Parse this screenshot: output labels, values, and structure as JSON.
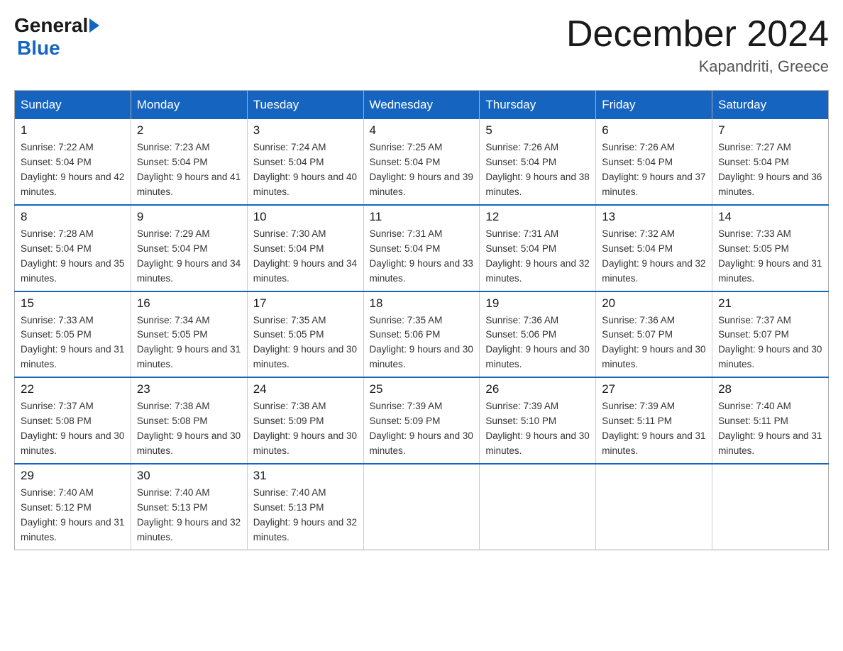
{
  "logo": {
    "general": "General",
    "blue": "Blue"
  },
  "title": "December 2024",
  "subtitle": "Kapandriti, Greece",
  "days_of_week": [
    "Sunday",
    "Monday",
    "Tuesday",
    "Wednesday",
    "Thursday",
    "Friday",
    "Saturday"
  ],
  "weeks": [
    [
      {
        "day": "1",
        "sunrise": "Sunrise: 7:22 AM",
        "sunset": "Sunset: 5:04 PM",
        "daylight": "Daylight: 9 hours and 42 minutes."
      },
      {
        "day": "2",
        "sunrise": "Sunrise: 7:23 AM",
        "sunset": "Sunset: 5:04 PM",
        "daylight": "Daylight: 9 hours and 41 minutes."
      },
      {
        "day": "3",
        "sunrise": "Sunrise: 7:24 AM",
        "sunset": "Sunset: 5:04 PM",
        "daylight": "Daylight: 9 hours and 40 minutes."
      },
      {
        "day": "4",
        "sunrise": "Sunrise: 7:25 AM",
        "sunset": "Sunset: 5:04 PM",
        "daylight": "Daylight: 9 hours and 39 minutes."
      },
      {
        "day": "5",
        "sunrise": "Sunrise: 7:26 AM",
        "sunset": "Sunset: 5:04 PM",
        "daylight": "Daylight: 9 hours and 38 minutes."
      },
      {
        "day": "6",
        "sunrise": "Sunrise: 7:26 AM",
        "sunset": "Sunset: 5:04 PM",
        "daylight": "Daylight: 9 hours and 37 minutes."
      },
      {
        "day": "7",
        "sunrise": "Sunrise: 7:27 AM",
        "sunset": "Sunset: 5:04 PM",
        "daylight": "Daylight: 9 hours and 36 minutes."
      }
    ],
    [
      {
        "day": "8",
        "sunrise": "Sunrise: 7:28 AM",
        "sunset": "Sunset: 5:04 PM",
        "daylight": "Daylight: 9 hours and 35 minutes."
      },
      {
        "day": "9",
        "sunrise": "Sunrise: 7:29 AM",
        "sunset": "Sunset: 5:04 PM",
        "daylight": "Daylight: 9 hours and 34 minutes."
      },
      {
        "day": "10",
        "sunrise": "Sunrise: 7:30 AM",
        "sunset": "Sunset: 5:04 PM",
        "daylight": "Daylight: 9 hours and 34 minutes."
      },
      {
        "day": "11",
        "sunrise": "Sunrise: 7:31 AM",
        "sunset": "Sunset: 5:04 PM",
        "daylight": "Daylight: 9 hours and 33 minutes."
      },
      {
        "day": "12",
        "sunrise": "Sunrise: 7:31 AM",
        "sunset": "Sunset: 5:04 PM",
        "daylight": "Daylight: 9 hours and 32 minutes."
      },
      {
        "day": "13",
        "sunrise": "Sunrise: 7:32 AM",
        "sunset": "Sunset: 5:04 PM",
        "daylight": "Daylight: 9 hours and 32 minutes."
      },
      {
        "day": "14",
        "sunrise": "Sunrise: 7:33 AM",
        "sunset": "Sunset: 5:05 PM",
        "daylight": "Daylight: 9 hours and 31 minutes."
      }
    ],
    [
      {
        "day": "15",
        "sunrise": "Sunrise: 7:33 AM",
        "sunset": "Sunset: 5:05 PM",
        "daylight": "Daylight: 9 hours and 31 minutes."
      },
      {
        "day": "16",
        "sunrise": "Sunrise: 7:34 AM",
        "sunset": "Sunset: 5:05 PM",
        "daylight": "Daylight: 9 hours and 31 minutes."
      },
      {
        "day": "17",
        "sunrise": "Sunrise: 7:35 AM",
        "sunset": "Sunset: 5:05 PM",
        "daylight": "Daylight: 9 hours and 30 minutes."
      },
      {
        "day": "18",
        "sunrise": "Sunrise: 7:35 AM",
        "sunset": "Sunset: 5:06 PM",
        "daylight": "Daylight: 9 hours and 30 minutes."
      },
      {
        "day": "19",
        "sunrise": "Sunrise: 7:36 AM",
        "sunset": "Sunset: 5:06 PM",
        "daylight": "Daylight: 9 hours and 30 minutes."
      },
      {
        "day": "20",
        "sunrise": "Sunrise: 7:36 AM",
        "sunset": "Sunset: 5:07 PM",
        "daylight": "Daylight: 9 hours and 30 minutes."
      },
      {
        "day": "21",
        "sunrise": "Sunrise: 7:37 AM",
        "sunset": "Sunset: 5:07 PM",
        "daylight": "Daylight: 9 hours and 30 minutes."
      }
    ],
    [
      {
        "day": "22",
        "sunrise": "Sunrise: 7:37 AM",
        "sunset": "Sunset: 5:08 PM",
        "daylight": "Daylight: 9 hours and 30 minutes."
      },
      {
        "day": "23",
        "sunrise": "Sunrise: 7:38 AM",
        "sunset": "Sunset: 5:08 PM",
        "daylight": "Daylight: 9 hours and 30 minutes."
      },
      {
        "day": "24",
        "sunrise": "Sunrise: 7:38 AM",
        "sunset": "Sunset: 5:09 PM",
        "daylight": "Daylight: 9 hours and 30 minutes."
      },
      {
        "day": "25",
        "sunrise": "Sunrise: 7:39 AM",
        "sunset": "Sunset: 5:09 PM",
        "daylight": "Daylight: 9 hours and 30 minutes."
      },
      {
        "day": "26",
        "sunrise": "Sunrise: 7:39 AM",
        "sunset": "Sunset: 5:10 PM",
        "daylight": "Daylight: 9 hours and 30 minutes."
      },
      {
        "day": "27",
        "sunrise": "Sunrise: 7:39 AM",
        "sunset": "Sunset: 5:11 PM",
        "daylight": "Daylight: 9 hours and 31 minutes."
      },
      {
        "day": "28",
        "sunrise": "Sunrise: 7:40 AM",
        "sunset": "Sunset: 5:11 PM",
        "daylight": "Daylight: 9 hours and 31 minutes."
      }
    ],
    [
      {
        "day": "29",
        "sunrise": "Sunrise: 7:40 AM",
        "sunset": "Sunset: 5:12 PM",
        "daylight": "Daylight: 9 hours and 31 minutes."
      },
      {
        "day": "30",
        "sunrise": "Sunrise: 7:40 AM",
        "sunset": "Sunset: 5:13 PM",
        "daylight": "Daylight: 9 hours and 32 minutes."
      },
      {
        "day": "31",
        "sunrise": "Sunrise: 7:40 AM",
        "sunset": "Sunset: 5:13 PM",
        "daylight": "Daylight: 9 hours and 32 minutes."
      },
      null,
      null,
      null,
      null
    ]
  ]
}
